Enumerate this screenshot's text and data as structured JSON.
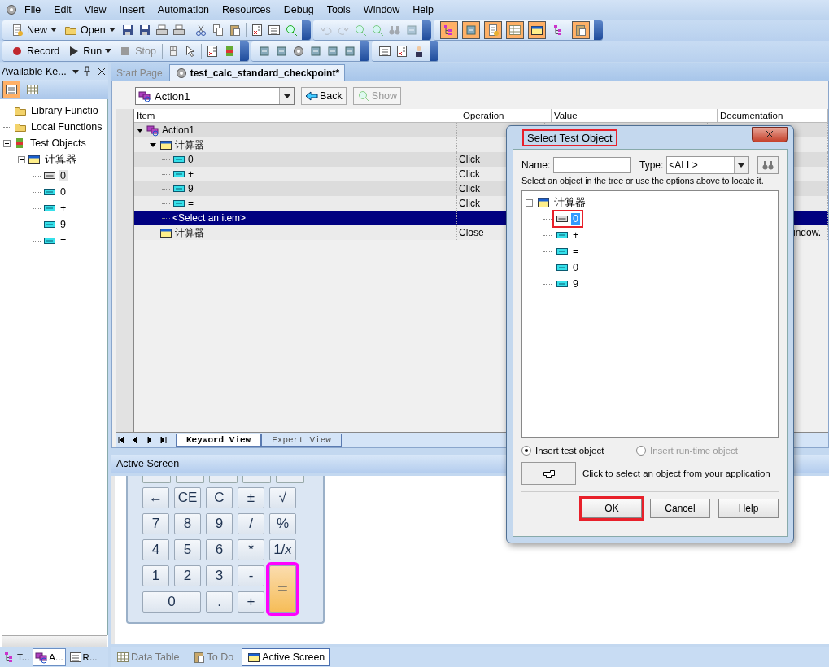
{
  "menu": [
    "File",
    "Edit",
    "View",
    "Insert",
    "Automation",
    "Resources",
    "Debug",
    "Tools",
    "Window",
    "Help"
  ],
  "toolbar_file": [
    {
      "label": "New",
      "kind": "new",
      "dropdown": true,
      "disabled": false
    },
    {
      "label": "Open",
      "kind": "open",
      "dropdown": true,
      "disabled": false
    }
  ],
  "toolbar_run": [
    {
      "label": "Record",
      "kind": "record",
      "dropdown": false,
      "disabled": false
    },
    {
      "label": "Run",
      "kind": "run",
      "dropdown": true,
      "disabled": false
    },
    {
      "label": "Stop",
      "kind": "stop",
      "dropdown": false,
      "disabled": true
    }
  ],
  "view_toggles": [
    {
      "on": true
    },
    {
      "on": true
    },
    {
      "on": true
    },
    {
      "on": true
    },
    {
      "on": true
    },
    {
      "on": false
    },
    {
      "on": true
    }
  ],
  "side_panel": {
    "title": "Available Ke...",
    "views": [
      {
        "selected": true
      },
      {
        "selected": false
      }
    ],
    "tree": [
      {
        "label": "Library Functio",
        "kind": "library",
        "selected": false
      },
      {
        "label": "Local Functions",
        "kind": "local",
        "selected": false
      },
      {
        "label": "Test Objects",
        "kind": "repository",
        "selected": false,
        "expanded": true,
        "children": [
          {
            "label": "计算器",
            "kind": "window",
            "selected": false,
            "expanded": true,
            "children": [
              {
                "label": "0",
                "kind": "static",
                "selected": true
              },
              {
                "label": "0",
                "kind": "button",
                "selected": false
              },
              {
                "label": "+",
                "kind": "button",
                "selected": false
              },
              {
                "label": "9",
                "kind": "button",
                "selected": false
              },
              {
                "label": "=",
                "kind": "button",
                "selected": false
              }
            ]
          }
        ]
      }
    ],
    "tabs": [
      {
        "label": "T...",
        "selected": false
      },
      {
        "label": "A...",
        "selected": true
      },
      {
        "label": "R...",
        "selected": false
      }
    ]
  },
  "doc_tabs": [
    {
      "label": "Start Page",
      "selected": false
    },
    {
      "label": "test_calc_standard_checkpoint*",
      "selected": true
    }
  ],
  "editor": {
    "action": "Action1",
    "back": {
      "label": "Back",
      "disabled": false
    },
    "show": {
      "label": "Show",
      "disabled": true
    },
    "columns": [
      "Item",
      "Operation",
      "Value",
      "Documentation"
    ],
    "steps": [
      {
        "item": "Action1",
        "kind": "action",
        "selected": false,
        "expanded": true,
        "children": [
          {
            "item": "计算器",
            "kind": "window",
            "selected": false,
            "expanded": true,
            "children": [
              {
                "item": "0",
                "kind": "button",
                "operation": "Click",
                "selected": false
              },
              {
                "item": "+",
                "kind": "button",
                "operation": "Click",
                "selected": false
              },
              {
                "item": "9",
                "kind": "button",
                "operation": "Click",
                "selected": false
              },
              {
                "item": "=",
                "kind": "button",
                "operation": "Click",
                "selected": false
              },
              {
                "item": "<Select an item>",
                "kind": "placeholder",
                "selected": true
              }
            ]
          },
          {
            "item": "计算器",
            "kind": "window",
            "operation": "Close",
            "documentation": "indow.",
            "selected": false
          }
        ]
      }
    ],
    "sheet_tabs": [
      {
        "label": "Keyword View",
        "selected": true
      },
      {
        "label": "Expert View",
        "selected": false
      }
    ]
  },
  "active_screen": {
    "title": "Active Screen",
    "keys": [
      {
        "label": "←",
        "kind": "normal",
        "highlighted": false
      },
      {
        "label": "CE",
        "kind": "normal",
        "highlighted": false
      },
      {
        "label": "C",
        "kind": "normal",
        "highlighted": false
      },
      {
        "label": "±",
        "kind": "normal",
        "highlighted": false
      },
      {
        "label": "√",
        "kind": "normal",
        "highlighted": false
      },
      {
        "label": "7",
        "kind": "normal",
        "highlighted": false
      },
      {
        "label": "8",
        "kind": "normal",
        "highlighted": false
      },
      {
        "label": "9",
        "kind": "normal",
        "highlighted": false
      },
      {
        "label": "/",
        "kind": "normal",
        "highlighted": false
      },
      {
        "label": "%",
        "kind": "normal",
        "highlighted": false
      },
      {
        "label": "4",
        "kind": "normal",
        "highlighted": false
      },
      {
        "label": "5",
        "kind": "normal",
        "highlighted": false
      },
      {
        "label": "6",
        "kind": "normal",
        "highlighted": false
      },
      {
        "label": "*",
        "kind": "normal",
        "highlighted": false
      },
      {
        "label": "1/*x*",
        "kind": "normal",
        "highlighted": false
      },
      {
        "label": "1",
        "kind": "normal",
        "highlighted": false
      },
      {
        "label": "2",
        "kind": "normal",
        "highlighted": false
      },
      {
        "label": "3",
        "kind": "normal",
        "highlighted": false
      },
      {
        "label": "-",
        "kind": "normal",
        "highlighted": false
      },
      {
        "label": "=",
        "kind": "tall",
        "highlighted": true
      },
      {
        "label": "0",
        "kind": "wide",
        "highlighted": false
      },
      {
        "label": ".",
        "kind": "normal",
        "highlighted": false
      },
      {
        "label": "+",
        "kind": "normal",
        "highlighted": false
      }
    ]
  },
  "bottom_tabs": [
    {
      "label": "Data Table",
      "selected": false
    },
    {
      "label": "To Do",
      "selected": false
    },
    {
      "label": "Active Screen",
      "selected": true
    }
  ],
  "dialog": {
    "title": "Select Test Object",
    "title_marked": true,
    "name_label": "Name:",
    "type_label": "Type:",
    "type_value": "<ALL>",
    "hint": "Select an object in the tree or use the options above to locate it.",
    "tree": [
      {
        "label": "计算器",
        "kind": "window",
        "selected": false,
        "marked": false,
        "expanded": true,
        "children": [
          {
            "label": "0",
            "kind": "static",
            "selected": true,
            "marked": true
          },
          {
            "label": "+",
            "kind": "button",
            "selected": false,
            "marked": false
          },
          {
            "label": "=",
            "kind": "button",
            "selected": false,
            "marked": false
          },
          {
            "label": "0",
            "kind": "button",
            "selected": false,
            "marked": false
          },
          {
            "label": "9",
            "kind": "button",
            "selected": false,
            "marked": false
          }
        ]
      }
    ],
    "options": [
      {
        "label": "Insert test object",
        "selected": true,
        "disabled": false
      },
      {
        "label": "Insert run-time object",
        "selected": false,
        "disabled": true
      }
    ],
    "pointer_hint": "Click to select an object from your application",
    "buttons": [
      {
        "label": "OK",
        "marked": true
      },
      {
        "label": "Cancel",
        "marked": false
      },
      {
        "label": "Help",
        "marked": false
      }
    ]
  }
}
